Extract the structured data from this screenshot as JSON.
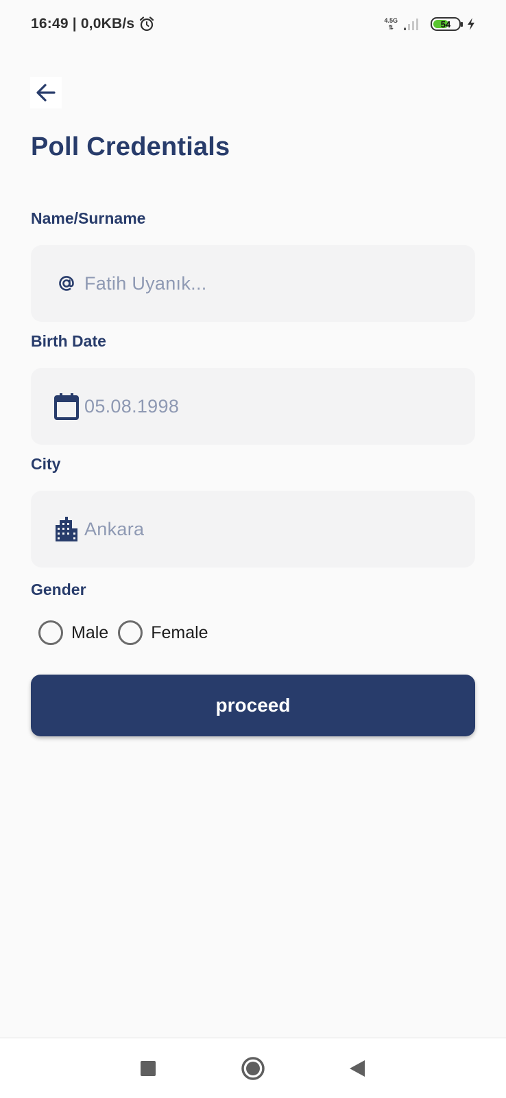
{
  "status_bar": {
    "time_speed": "16:49 | 0,0KB/s",
    "network_type": "4.5G",
    "battery_level": "54",
    "battery_fraction": 0.54,
    "icons": [
      "alarm-icon",
      "signal-icon",
      "battery-icon",
      "charging-icon"
    ]
  },
  "header": {
    "back_icon": "arrow-left-icon",
    "title": "Poll Credentials"
  },
  "form": {
    "name": {
      "label": "Name/Surname",
      "value": "Fatih Uyanık...",
      "icon": "at-icon"
    },
    "birth_date": {
      "label": "Birth Date",
      "value": "05.08.1998",
      "icon": "calendar-icon"
    },
    "city": {
      "label": "City",
      "value": "Ankara",
      "icon": "city-icon"
    },
    "gender": {
      "label": "Gender",
      "options": [
        "Male",
        "Female"
      ],
      "selected": null
    },
    "submit_label": "proceed"
  },
  "nav_bar": {
    "icons": [
      "recents-square-icon",
      "home-circle-icon",
      "back-triangle-icon"
    ]
  },
  "colors": {
    "primary": "#283c6b",
    "input_bg": "#f3f3f4",
    "placeholder": "#8e99b3",
    "background": "#fafafa"
  }
}
